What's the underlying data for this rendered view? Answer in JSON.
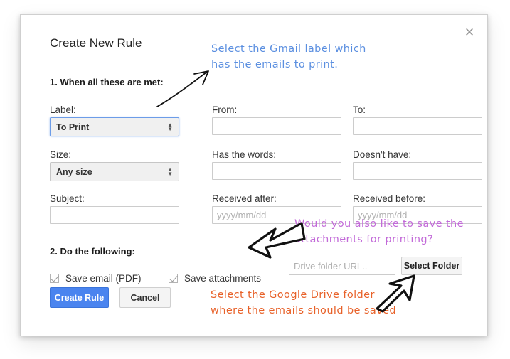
{
  "dialog": {
    "title": "Create New Rule",
    "close_icon": "close-icon",
    "step1_heading": "1. When all these are met:",
    "step2_heading": "2. Do the following:"
  },
  "fields": {
    "label": {
      "label": "Label:",
      "value": "To Print",
      "focused": true
    },
    "from": {
      "label": "From:",
      "value": "",
      "placeholder": ""
    },
    "to": {
      "label": "To:",
      "value": "",
      "placeholder": ""
    },
    "size": {
      "label": "Size:",
      "value": "Any size",
      "focused": false
    },
    "has_words": {
      "label": "Has the words:",
      "value": "",
      "placeholder": ""
    },
    "doesnt_have": {
      "label": "Doesn't have:",
      "value": "",
      "placeholder": ""
    },
    "subject": {
      "label": "Subject:",
      "value": "",
      "placeholder": ""
    },
    "received_after": {
      "label": "Received after:",
      "value": "",
      "placeholder": "yyyy/mm/dd"
    },
    "received_before": {
      "label": "Received before:",
      "value": "",
      "placeholder": "yyyy/mm/dd"
    }
  },
  "actions": {
    "save_email_label": "Save email (PDF)",
    "save_email_checked": true,
    "save_attachments_label": "Save attachments",
    "save_attachments_checked": true,
    "drive_folder_value": "",
    "drive_folder_placeholder": "Drive folder URL..",
    "select_folder_label": "Select Folder"
  },
  "footer": {
    "create_label": "Create Rule",
    "cancel_label": "Cancel"
  },
  "annotations": {
    "blue": "Select the Gmail label which\nhas the emails to print.",
    "purple": "Would you also like to save the\nattachments for printing?",
    "orange": "Select the Google Drive folder\nwhere the emails should be saved"
  },
  "colors": {
    "accent_blue": "#4a84ef",
    "note_blue": "#5b8fe0",
    "note_purple": "#c26ad8",
    "note_orange": "#e8622a",
    "select_focus": "#6c9ce8"
  }
}
